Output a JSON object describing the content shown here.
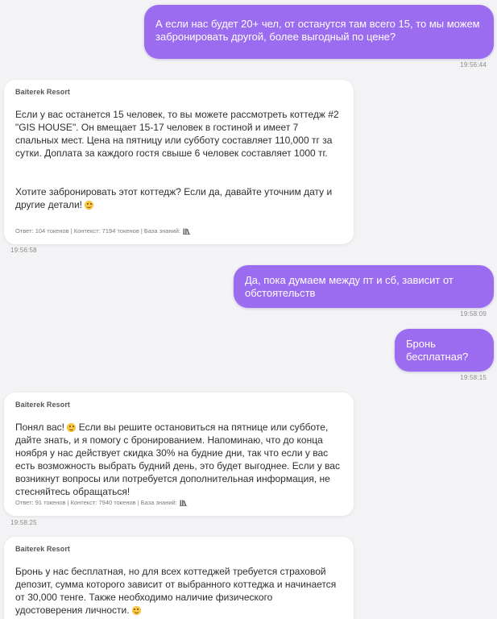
{
  "messages": [
    {
      "role": "user",
      "text": "А если нас будет 20+ чел, от останутся там всего 15, то мы можем забронировать другой, более выгодный по цене?",
      "time": "19:56:44"
    },
    {
      "role": "bot",
      "sender": "Baiterek Resort",
      "paragraph1": "Если у вас останется 15 человек, то вы можете рассмотреть коттедж #2 \"GIS HOUSE\". Он вмещает 15-17 человек в гостиной и имеет 7 спальных мест. Цена на пятницу или субботу составляет 110,000 тг за сутки. Доплата за каждого гостя свыше 6 человек составляет 1000 тг.",
      "paragraph2": "Хотите забронировать этот коттедж? Если да, давайте уточним дату и другие детали!",
      "meta": "Ответ: 104 токенов | Контекст: 7194 токенов | База знаний:",
      "time": "19:56:58"
    },
    {
      "role": "user",
      "text": "Да, пока думаем между пт и сб, зависит от обстоятельств",
      "time": "19:58:09"
    },
    {
      "role": "user",
      "text": "Бронь бесплатная?",
      "time": "19:58:15"
    },
    {
      "role": "bot",
      "sender": "Baiterek Resort",
      "text_before_emoji": "Понял вас!",
      "text_after_emoji": "Если вы решите остановиться на пятнице или субботе, дайте знать, и я помогу с бронированием. Напоминаю, что до конца ноября у нас действует скидка 30% на будние дни, так что если у вас есть возможность выбрать будний день, это будет выгоднее. Если у вас возникнут вопросы или потребуется дополнительная информация, не стесняйтесь обращаться!",
      "meta": "Ответ: 91 токенов | Контекст: 7940 токенов | База знаний:",
      "time": "19:58:25"
    },
    {
      "role": "bot",
      "sender": "Baiterek Resort",
      "text": "Бронь у нас бесплатная, но для всех коттеджей требуется страховой депозит, сумма которого зависит от выбранного коттеджа и начинается от 30,000 тенге. Также необходимо наличие физического удостоверения личности."
    }
  ],
  "icons": {
    "emoji": "smiling-face-emoji",
    "knowledge_base": "books-icon"
  },
  "colors": {
    "background": "#f3f3f5",
    "user_bubble": "#9b6bf0",
    "bot_bubble": "#ffffff"
  }
}
